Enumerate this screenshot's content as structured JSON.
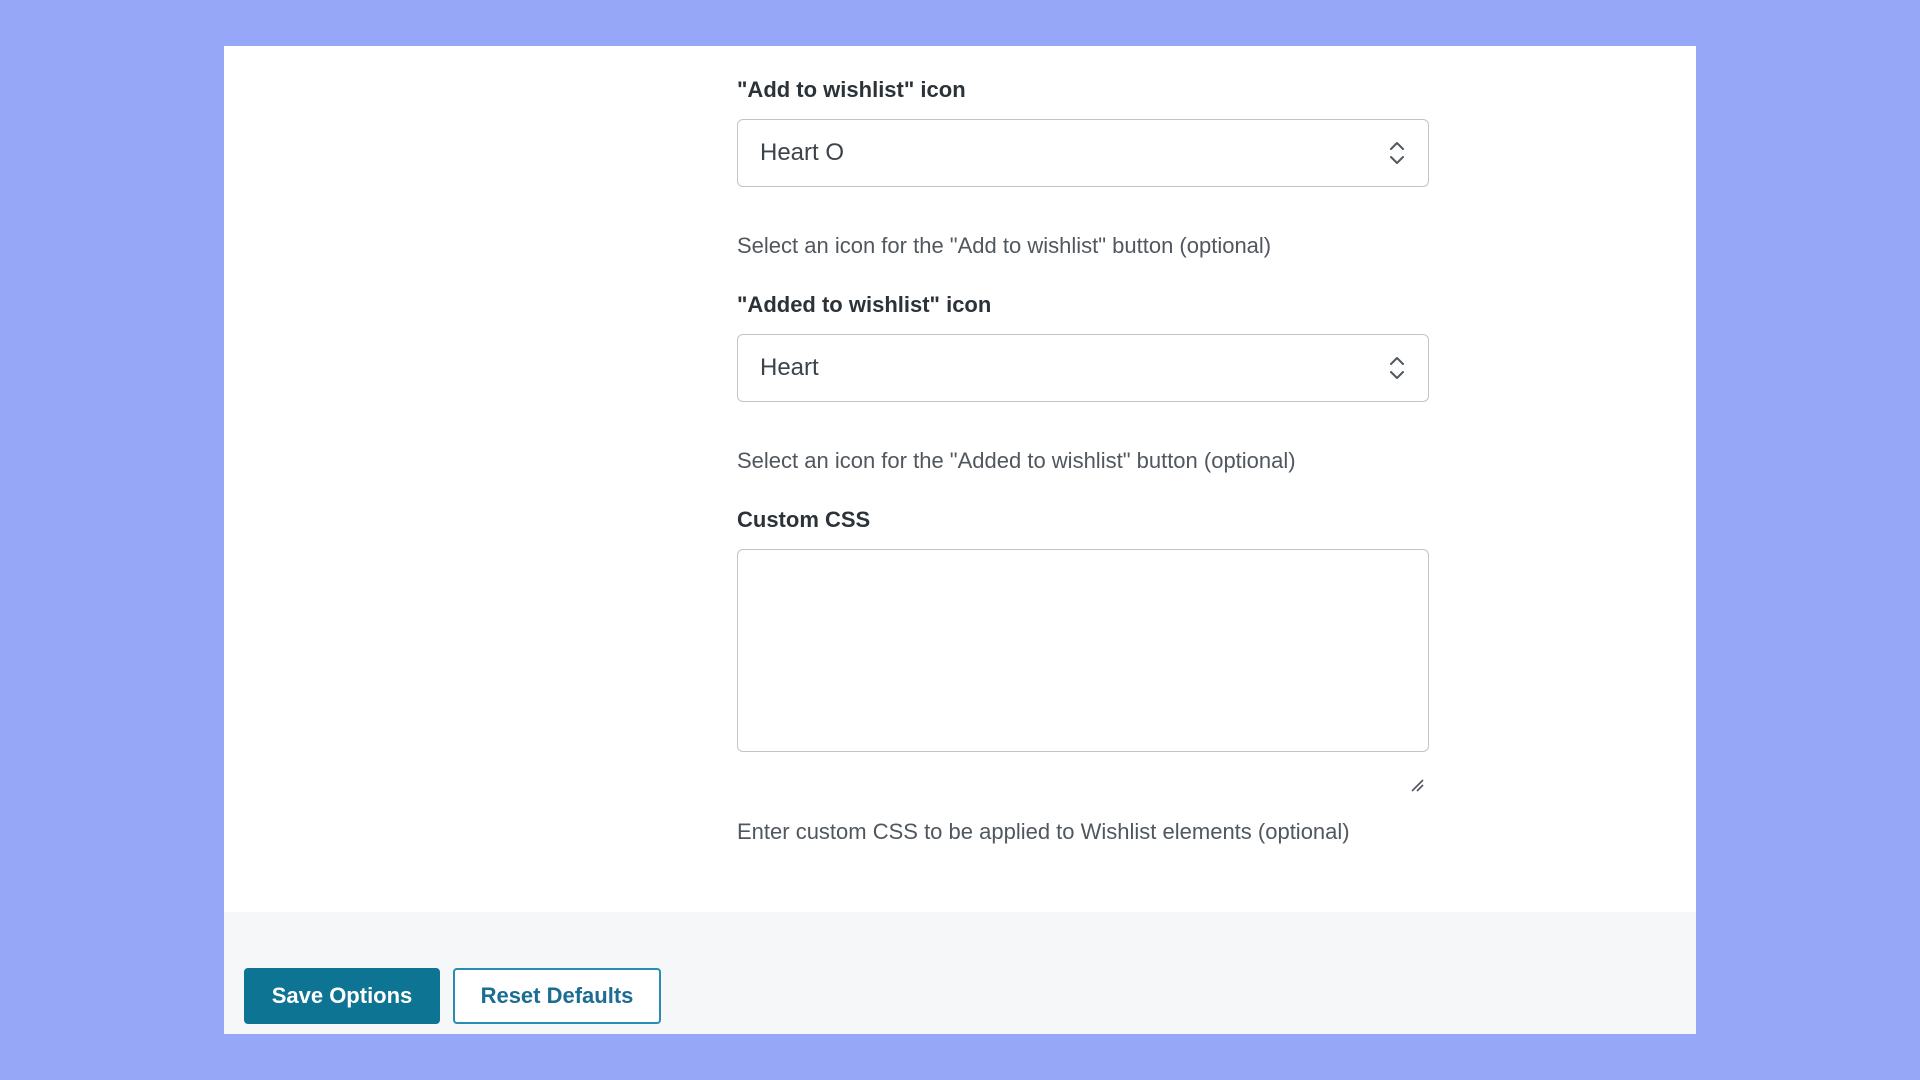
{
  "colors": {
    "background": "#97a7f8",
    "primary_button": "#0e7493",
    "secondary_button_border": "#2a8cb3"
  },
  "fields": {
    "add_icon": {
      "label": "\"Add to wishlist\" icon",
      "value": "Heart O",
      "help": "Select an icon for the \"Add to wishlist\" button (optional)",
      "control_icon": "chevron-up-down-icon"
    },
    "added_icon": {
      "label": "\"Added to wishlist\" icon",
      "value": "Heart",
      "help": "Select an icon for the \"Added to wishlist\" button (optional)",
      "control_icon": "chevron-up-down-icon"
    },
    "custom_css": {
      "label": "Custom CSS",
      "value": "",
      "help": "Enter custom CSS to be applied to Wishlist elements (optional)",
      "control_icon": "resize-grip-icon"
    }
  },
  "footer": {
    "save_label": "Save Options",
    "reset_label": "Reset Defaults"
  }
}
